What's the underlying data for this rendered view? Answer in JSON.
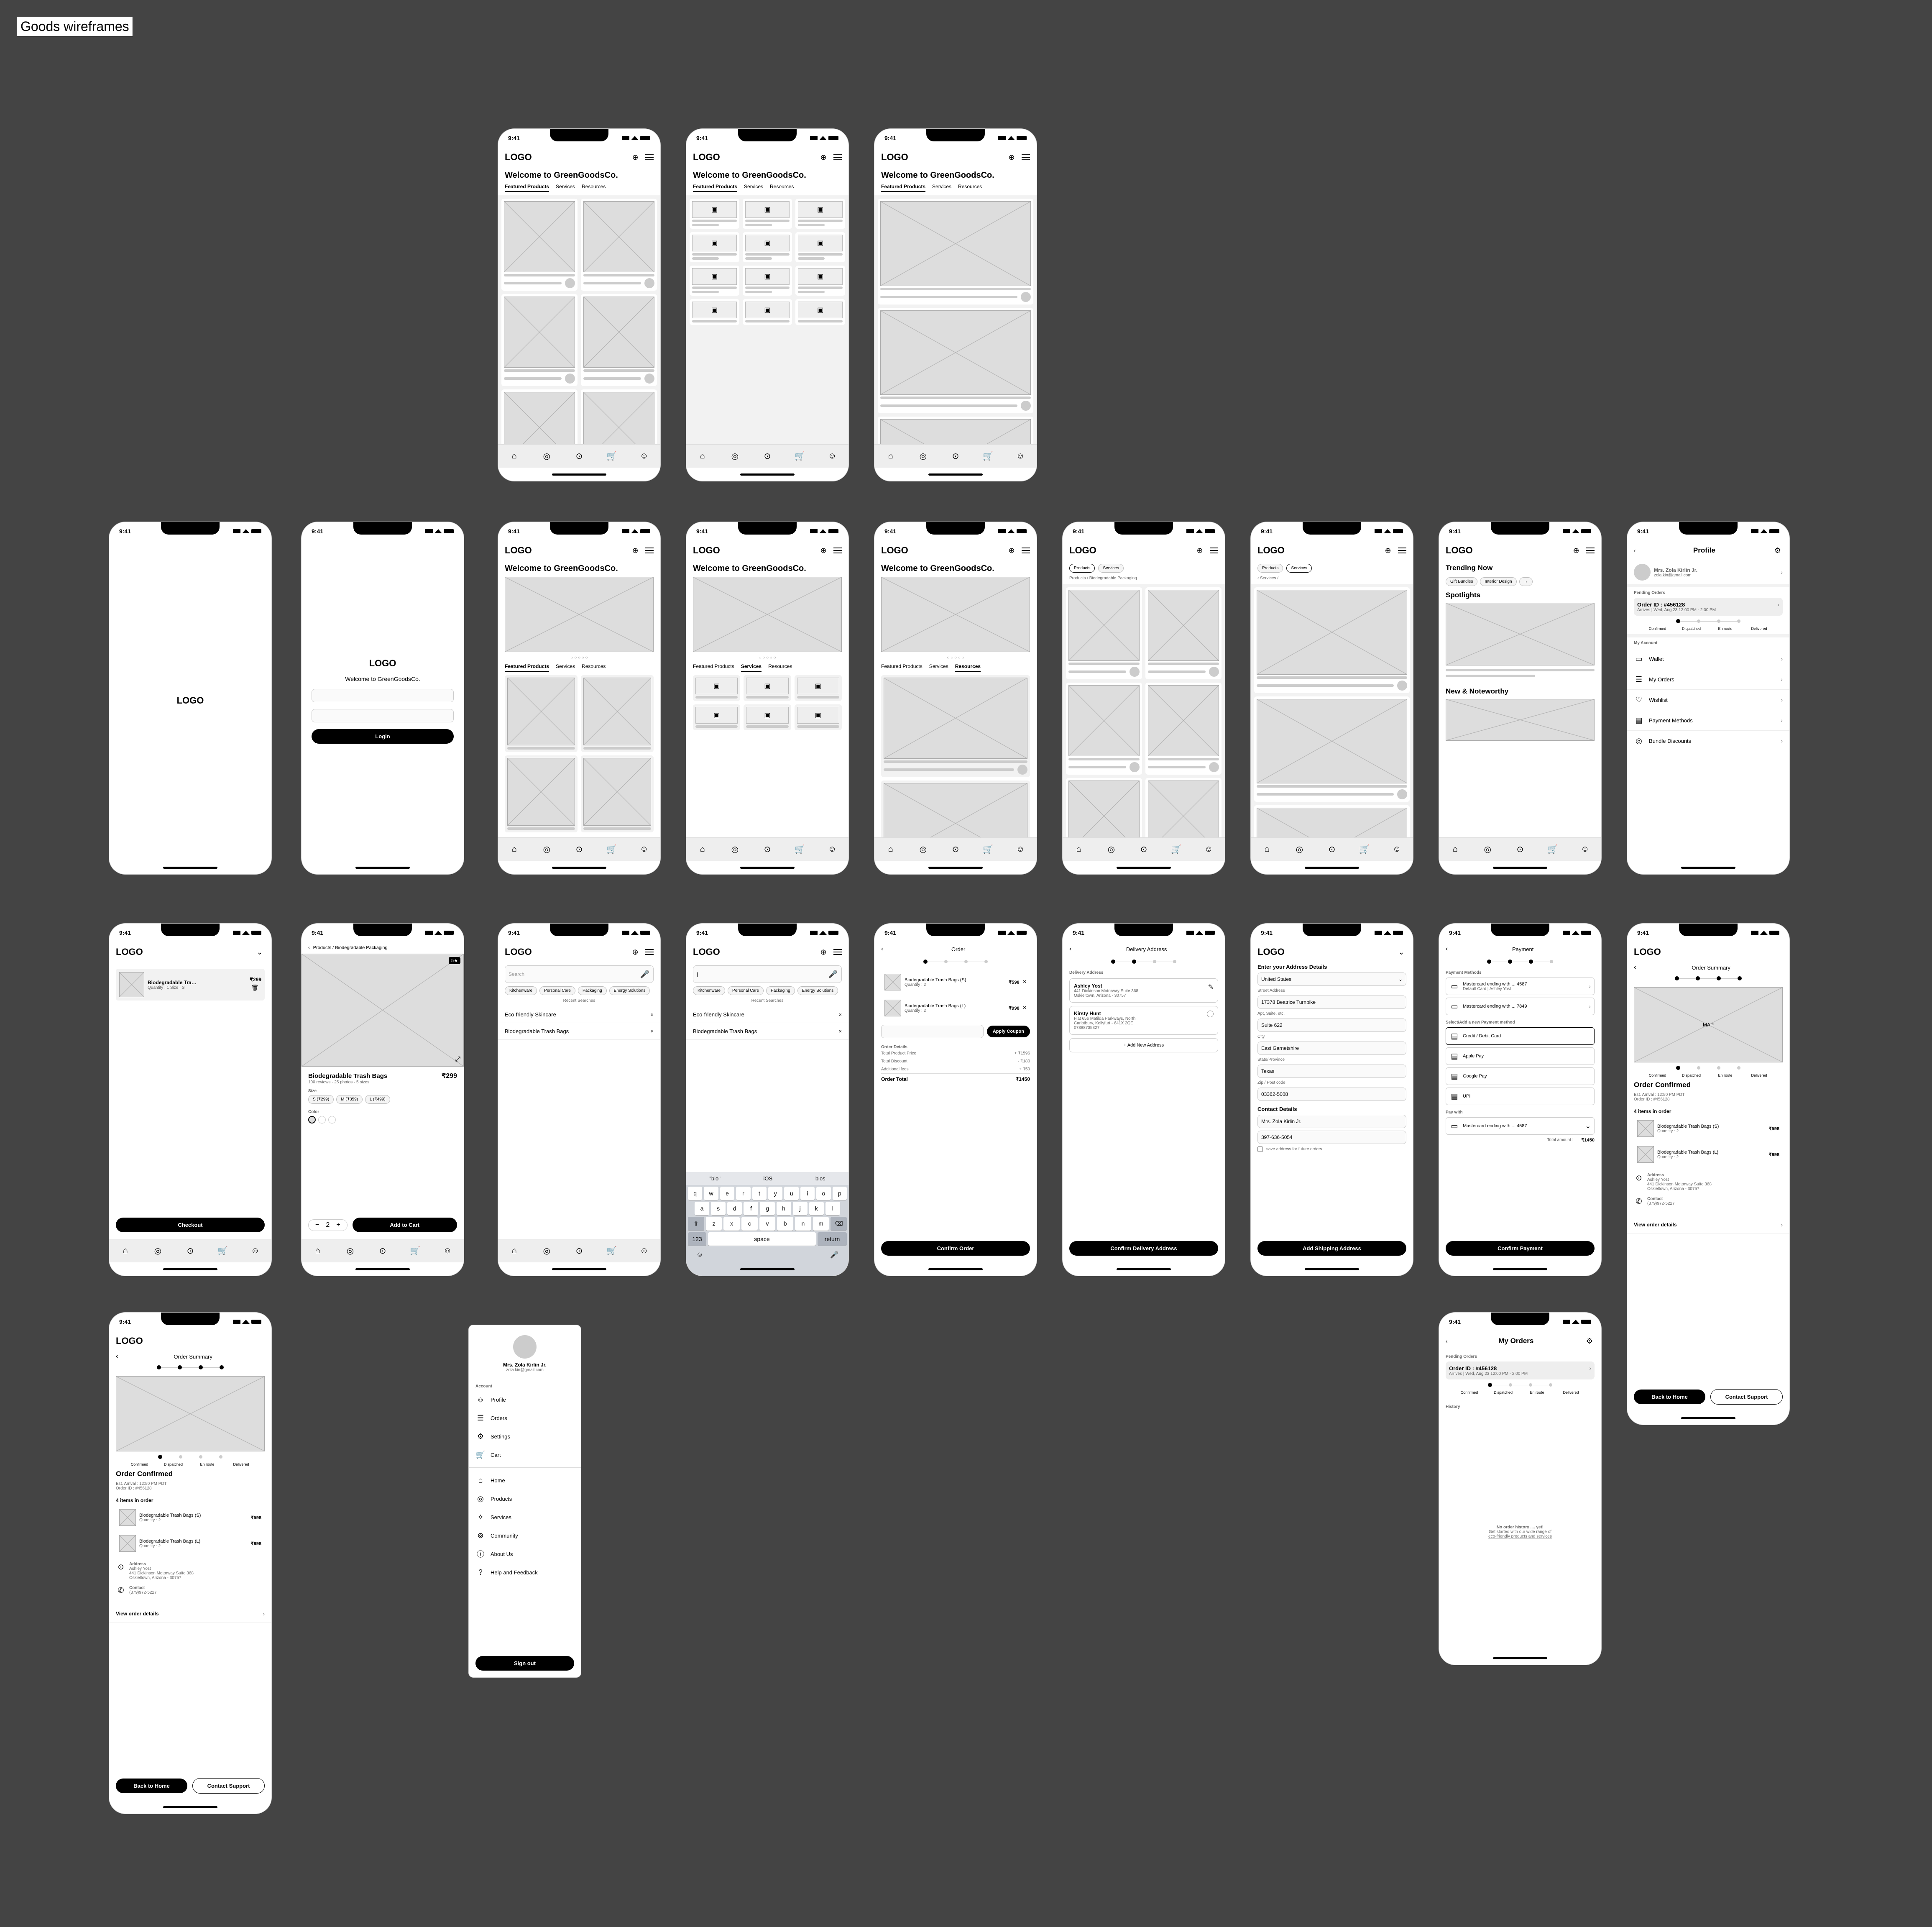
{
  "file_tag": "Goods wireframes",
  "time": "9:41",
  "logo": "LOGO",
  "welcome": "Welcome to GreenGoodsCo.",
  "tabs": {
    "featured": "Featured Products",
    "services": "Services",
    "resources": "Resources"
  },
  "login": {
    "btn": "Login"
  },
  "breadcrumb": "Products / Biodegradable Packaging",
  "prod_tab": {
    "products": "Products",
    "services": "Services"
  },
  "inspire": {
    "trending": "Trending Now",
    "tags": [
      "Gift Bundles",
      "Interior Design"
    ],
    "spotlights": "Spotlights",
    "new": "New & Noteworthy"
  },
  "profile": {
    "title": "Profile",
    "user_name": "Mrs. Zola Kirlin Jr.",
    "user_email": "zola.kin@gmail.com",
    "pending": "Pending Orders",
    "order_id": "Order ID : #456128",
    "arrives": "Arrives | Wed, Aug 23 12:00 PM - 2:00 PM",
    "steps": [
      "Confirmed",
      "Dispatched",
      "En route",
      "Delivered"
    ],
    "my_account": "My Account",
    "items": [
      "Wallet",
      "My Orders",
      "Wishlist",
      "Payment Methods",
      "Bundle Discounts"
    ]
  },
  "cart": {
    "item": "Biodegradable Tra…",
    "qty": "Quantity : 1  Size : S",
    "price": "₹299",
    "checkout": "Checkout"
  },
  "pdp": {
    "name": "Biodegradable Trash Bags",
    "price": "₹299",
    "reviews": "100 reviews · 25 photos · 5 sizes",
    "badge": "5★",
    "size": "Size",
    "sizes": [
      "S (₹299)",
      "M (₹359)",
      "L (₹499)"
    ],
    "color": "Color",
    "add": "Add to Cart"
  },
  "search": {
    "placeholder": "Search",
    "chips": [
      "Kitchenware",
      "Personal Care",
      "Packaging",
      "Energy Solutions"
    ],
    "recent": "Recent Searches",
    "r1": "Eco-friendly Skincare",
    "r2": "Biodegradable Trash Bags",
    "sug": [
      "\"bio\"",
      "iOS",
      "bios"
    ]
  },
  "order": {
    "title": "Order",
    "item1": "Biodegradable Trash Bags (S)",
    "p1": "₹598",
    "q1": "Quantity : 2",
    "item2": "Biodegradable Trash Bags (L)",
    "p2": "₹998",
    "q2": "Quantity : 2",
    "apply": "Apply Coupon",
    "details": "Order Details",
    "total_prod": "Total Product Price",
    "total_prod_v": "+ ₹1596",
    "discount": "Total Discount",
    "discount_v": "- ₹180",
    "fees": "Additional fees",
    "fees_v": "+ ₹50",
    "ototal": "Order Total",
    "ototal_v": "₹1450",
    "confirm": "Confirm Order"
  },
  "delivery": {
    "title": "Delivery Address",
    "sub": "Delivery Address",
    "a1_name": "Ashley Yost",
    "a1_l1": "441 Dickinson Motorway Suite 368",
    "a1_l2": "Oskieltown, Arizona - 30757",
    "a2_name": "Kirsty Hunt",
    "a2_l1": "Flat 65e Matilda Parkways, North",
    "a2_l2": "Carlotbury, Kellyfurt - 641X 2QE",
    "a2_phone": "07388735327",
    "add_new": "+ Add New Address",
    "confirm": "Confirm Delivery Address"
  },
  "address_form": {
    "title": "Enter your Address Details",
    "country": "United States",
    "street_lbl": "Street Address",
    "street": "17378 Beatrice Turnpike",
    "apt_lbl": "Apt, Suite, etc.",
    "apt": "Suite 622",
    "city_lbl": "City",
    "city": "East Garnetshire",
    "state_lbl": "State/Province",
    "state": "Texas",
    "zip_lbl": "Zip / Post code",
    "zip": "03362-5008",
    "contact": "Contact Details",
    "name": "Mrs. Zola Kirlin Jr.",
    "phone": "397-636-5054",
    "save": "save address for future orders",
    "btn": "Add Shipping Address"
  },
  "payment": {
    "title": "Payment",
    "methods": "Payment Methods",
    "c1": "Mastercard ending with ... 4587",
    "c1_sub": "Default Card | Ashley Yost",
    "c2": "Mastercard ending with ... 7849",
    "new": "Select/Add a new Payment method",
    "opts": [
      "Credit / Debit Card",
      "Apple Pay",
      "Google Pay",
      "UPI"
    ],
    "pay_with": "Pay with",
    "sel": "Mastercard ending with ... 4587",
    "total": "Total amount :",
    "total_v": "₹1450",
    "btn": "Confirm Payment"
  },
  "summary": {
    "title": "Order Summary",
    "map": "MAP",
    "confirmed": "Order Confirmed",
    "eta": "Est. Arrival : 12:50 PM PDT",
    "oid": "Order ID : #456128",
    "count": "4 items in order",
    "addr": "Address",
    "contact": "Contact",
    "phone": "(379)972-5227",
    "view": "View order details",
    "back": "Back to Home",
    "support": "Contact Support"
  },
  "my_orders": {
    "title": "My Orders",
    "history": "History",
    "empty1": "No order history .... yet!",
    "empty2": "Get started with our wide range of",
    "empty3": "eco-friendly products and services"
  },
  "drawer": {
    "account": "Account",
    "items1": [
      "Profile",
      "Orders",
      "Settings",
      "Cart"
    ],
    "items2": [
      "Home",
      "Products",
      "Services",
      "Community",
      "About Us",
      "Help and Feedback"
    ],
    "signout": "Sign out"
  }
}
